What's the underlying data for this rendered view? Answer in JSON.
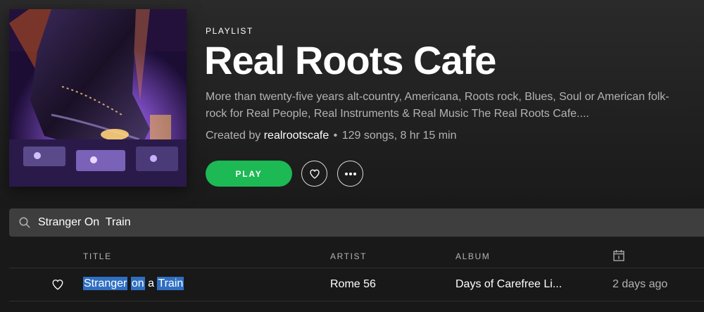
{
  "playlist": {
    "eyebrow": "PLAYLIST",
    "title": "Real Roots Cafe",
    "description_line1": "More than twenty-five years alt-country, Americana, Roots rock, Blues, Soul or American folk-",
    "description_line2": "rock for Real People, Real Instruments & Real Music The Real Roots Cafe....",
    "created_by_prefix": "Created by",
    "owner": "realrootscafe",
    "separator": "•",
    "stats": "129 songs, 8 hr 15 min",
    "cover_icon": "playlist-cover-image"
  },
  "actions": {
    "play_label": "PLAY",
    "like_icon": "heart-outline-icon",
    "more_icon": "ellipsis-icon"
  },
  "filter": {
    "icon": "search-icon",
    "value": "Stranger On  Train"
  },
  "tracklist": {
    "columns": {
      "title": "TITLE",
      "artist": "ARTIST",
      "album": "ALBUM",
      "date_added_icon": "calendar-icon"
    },
    "rows": [
      {
        "title_parts": [
          "Stranger",
          " ",
          "on",
          " a ",
          "Train"
        ],
        "artist": "Rome 56",
        "album": "Days of Carefree Li...",
        "added": "2 days ago"
      }
    ]
  },
  "colors": {
    "accent": "#1db954",
    "highlight": "#2f6fc2",
    "muted_text": "#b3b3b3",
    "filter_bg": "#3e3e3e"
  }
}
